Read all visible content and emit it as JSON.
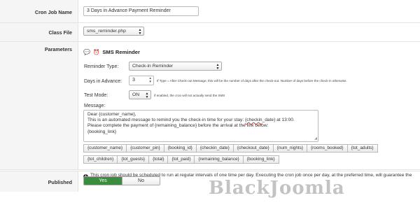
{
  "cron_job_name": {
    "label": "Cron Job Name",
    "value": "3 Days in Advance Payment Reminder"
  },
  "class_file": {
    "label": "Class File",
    "value": "sms_reminder.php"
  },
  "parameters": {
    "label": "Parameters",
    "section_title": "SMS Reminder",
    "reminder_type": {
      "label": "Reminder Type:",
      "value": "Check-in Reminder"
    },
    "days_in_advance": {
      "label": "Days in Advance:",
      "value": "3",
      "hint": "If Type = After Check-out Message, this will be the number of days after the check-out. Number of days before the check-in otherwise."
    },
    "test_mode": {
      "label": "Test Mode:",
      "value": "ON",
      "hint": "if enabled, the cron will not actually send the SMS"
    },
    "message": {
      "label": "Message:",
      "line1": "Dear {customer_name},",
      "line2_a": "This is an automated message to remind you the check-in time for your stay: ",
      "line2_u": "{checkin",
      "line2_b": "_date} at 13:00.",
      "line3": "Please complete the payment of {remaining_balance} before the arrival at the link below:",
      "line4": "{booking_link}"
    },
    "tags_row1": [
      "{customer_name}",
      "{customer_pin}",
      "{booking_id}",
      "{checkin_date}",
      "{checkout_date}",
      "{num_nights}",
      "{rooms_booked}",
      "{tot_adults}"
    ],
    "tags_row2": [
      "{tot_children}",
      "{tot_guests}",
      "{total}",
      "{tot_paid}",
      "{remaining_balance}",
      "{booking_link}"
    ],
    "info_note": "This cron job should be scheduled to run at regular intervals of one time per day. Executing the cron job once per day, at the preferred time, will guarantee the best result."
  },
  "published": {
    "label": "Published",
    "yes_label": "Yes",
    "no_label": "No",
    "selected": "Yes"
  },
  "watermark": "BlackJoomla",
  "colors": {
    "published_yes": "#3a8d3c",
    "label_bg": "#f5f5f5"
  }
}
